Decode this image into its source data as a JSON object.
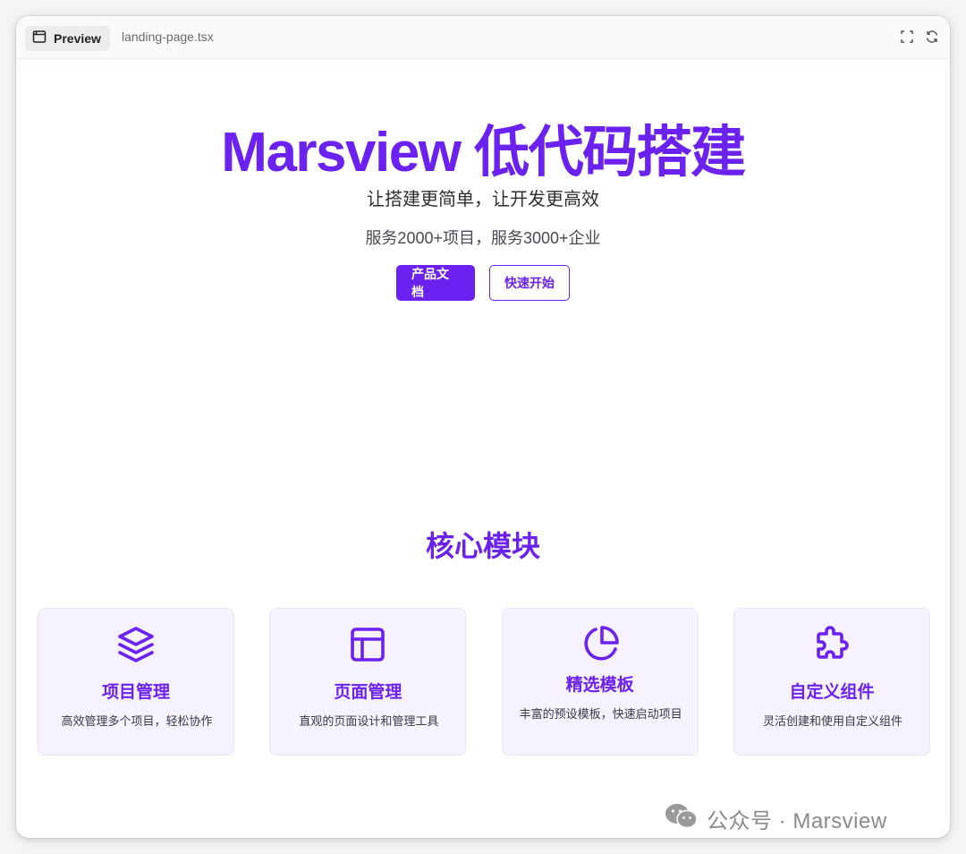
{
  "toolbar": {
    "preview_label": "Preview",
    "file_name": "landing-page.tsx"
  },
  "hero": {
    "title": "Marsview 低代码搭建",
    "subtitle": "让搭建更简单，让开发更高效",
    "stats": "服务2000+项目，服务3000+企业",
    "primary_button": "产品文档",
    "secondary_button": "快速开始"
  },
  "modules": {
    "title": "核心模块",
    "cards": [
      {
        "icon": "layers-icon",
        "title": "项目管理",
        "desc": "高效管理多个项目，轻松协作"
      },
      {
        "icon": "layout-icon",
        "title": "页面管理",
        "desc": "直观的页面设计和管理工具"
      },
      {
        "icon": "pie-chart-icon",
        "title": "精选模板",
        "desc": "丰富的预设模板，快速启动项目"
      },
      {
        "icon": "puzzle-icon",
        "title": "自定义组件",
        "desc": "灵活创建和使用自定义组件"
      }
    ]
  },
  "watermark": {
    "text": "公众号 · Marsview"
  },
  "colors": {
    "brand": "#6b21f0",
    "card_bg": "#f7f2ff"
  }
}
